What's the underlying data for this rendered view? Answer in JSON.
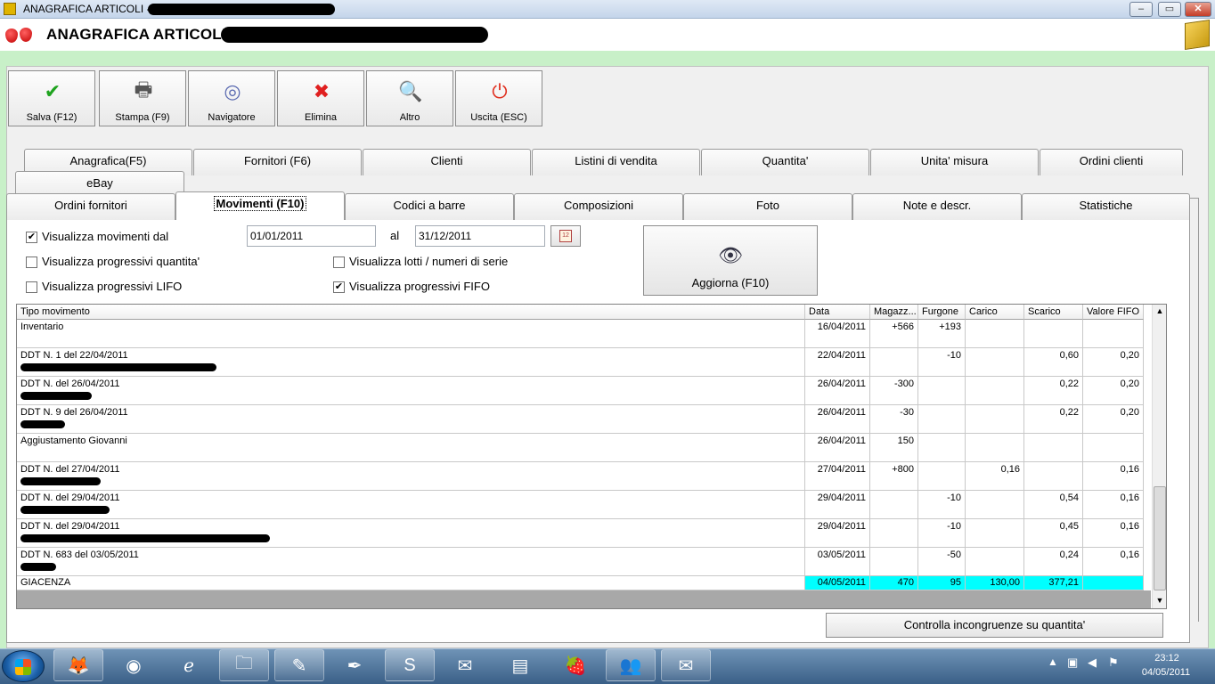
{
  "window": {
    "title": "ANAGRAFICA ARTICOLI -",
    "minimize": "–",
    "maximize": "▭",
    "close": "✕"
  },
  "header": {
    "title": "ANAGRAFICA ARTICOLI -"
  },
  "toolbar": [
    {
      "label": "Salva (F12)",
      "icon": "check-icon",
      "glyph": "✔",
      "color": "#1fa31f"
    },
    {
      "label": "Stampa (F9)",
      "icon": "printer-icon",
      "glyph": "🖶",
      "color": "#555555"
    },
    {
      "label": "Navigatore",
      "icon": "compass-icon",
      "glyph": "◎",
      "color": "#5a6ab0"
    },
    {
      "label": "Elimina",
      "icon": "delete-x-icon",
      "glyph": "✖",
      "color": "#e02020"
    },
    {
      "label": "Altro",
      "icon": "search-doc-icon",
      "glyph": "🔍",
      "color": "#2a70c8"
    },
    {
      "label": "Uscita (ESC)",
      "icon": "power-icon",
      "glyph": "⏻",
      "color": "#e03020"
    }
  ],
  "tabs_row1": [
    "Anagrafica(F5)",
    "Fornitori (F6)",
    "Clienti",
    "Listini di vendita",
    "Quantita'",
    "Unita' misura",
    "Ordini clienti"
  ],
  "tabs_row1b": [
    "eBay"
  ],
  "tabs_row2": [
    "Ordini fornitori",
    "Movimenti (F10)",
    "Codici a barre",
    "Composizioni",
    "Foto",
    "Note e descr.",
    "Statistiche"
  ],
  "active_tab": "Movimenti (F10)",
  "filters": {
    "show_from": {
      "label": "Visualizza movimenti dal",
      "checked": true
    },
    "from_date": "01/01/2011",
    "al_label": "al",
    "to_date": "31/12/2011",
    "prog_qty": {
      "label": "Visualizza progressivi quantita'",
      "checked": false
    },
    "prog_lifo": {
      "label": "Visualizza progressivi LIFO",
      "checked": false
    },
    "lots": {
      "label": "Visualizza lotti /  numeri di serie",
      "checked": false
    },
    "prog_fifo": {
      "label": "Visualizza progressivi FIFO",
      "checked": true
    }
  },
  "refresh_button": "Aggiorna (F10)",
  "grid": {
    "columns": [
      "Tipo movimento",
      "Data",
      "Magazz...",
      "Furgone",
      "Carico",
      "Scarico",
      "Valore FIFO"
    ],
    "rows": [
      {
        "tipo": "Inventario",
        "data": "16/04/2011",
        "mag": "+566",
        "furg": "+193",
        "carico": "",
        "scarico": "",
        "fifo": ""
      },
      {
        "tipo": "DDT N.  1 del 22/04/2011",
        "data": "22/04/2011",
        "mag": "",
        "furg": "-10",
        "carico": "",
        "scarico": "0,60",
        "fifo": "0,20"
      },
      {
        "tipo": "DDT N.   del 26/04/2011",
        "data": "26/04/2011",
        "mag": "-300",
        "furg": "",
        "carico": "",
        "scarico": "0,22",
        "fifo": "0,20"
      },
      {
        "tipo": "DDT N.   9 del 26/04/2011",
        "data": "26/04/2011",
        "mag": "-30",
        "furg": "",
        "carico": "",
        "scarico": "0,22",
        "fifo": "0,20"
      },
      {
        "tipo": "Aggiustamento Giovanni",
        "data": "26/04/2011",
        "mag": "150",
        "furg": "",
        "carico": "",
        "scarico": "",
        "fifo": ""
      },
      {
        "tipo": "DDT N.   del 27/04/2011",
        "data": "27/04/2011",
        "mag": "+800",
        "furg": "",
        "carico": "0,16",
        "scarico": "",
        "fifo": "0,16"
      },
      {
        "tipo": "DDT N.   del 29/04/2011",
        "data": "29/04/2011",
        "mag": "",
        "furg": "-10",
        "carico": "",
        "scarico": "0,54",
        "fifo": "0,16"
      },
      {
        "tipo": "DDT N.   del 29/04/2011",
        "data": "29/04/2011",
        "mag": "",
        "furg": "-10",
        "carico": "",
        "scarico": "0,45",
        "fifo": "0,16"
      },
      {
        "tipo": "DDT N. 683 del 03/05/2011",
        "data": "03/05/2011",
        "mag": "",
        "furg": "-50",
        "carico": "",
        "scarico": "0,24",
        "fifo": "0,16"
      }
    ],
    "total": {
      "tipo": "GIACENZA",
      "data": "04/05/2011",
      "mag": "470",
      "furg": "95",
      "carico": "130,00",
      "scarico": "377,21",
      "fifo": ""
    }
  },
  "check_button": "Controlla incongruenze su quantita'",
  "taskbar": {
    "time": "23:12",
    "date": "04/05/2011"
  }
}
